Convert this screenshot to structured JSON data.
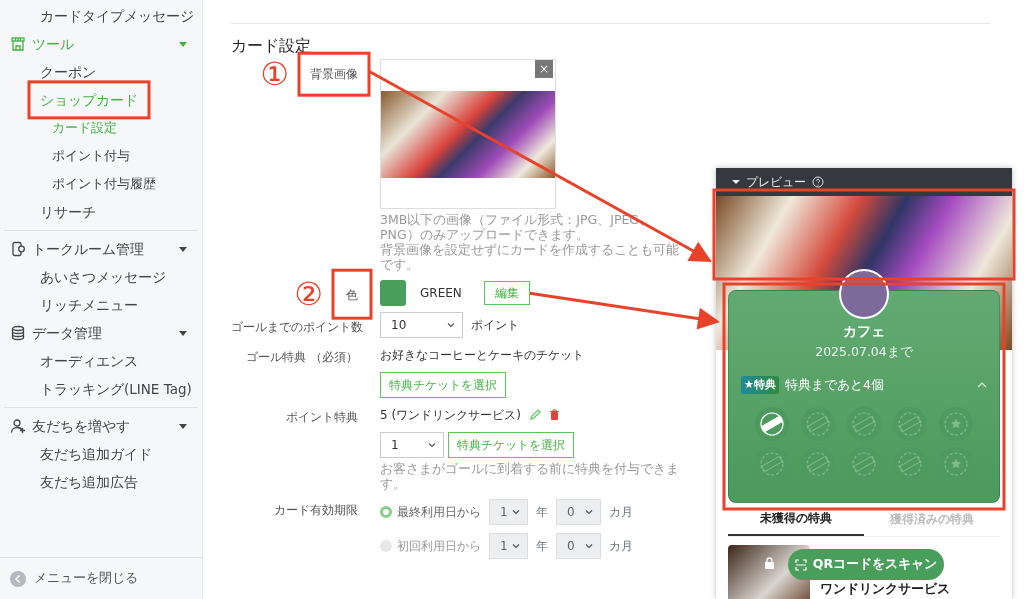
{
  "sidebar": {
    "entries": [
      {
        "kind": "item",
        "label": "カードタイプメッセージ",
        "selected": false
      },
      {
        "kind": "section",
        "label": "ツール",
        "selected": true,
        "expanded": true,
        "children": [
          {
            "label": "クーポン",
            "selected": false
          },
          {
            "label": "ショップカード",
            "selected": true,
            "children": [
              {
                "label": "カード設定",
                "selected": true
              },
              {
                "label": "ポイント付与",
                "selected": false
              },
              {
                "label": "ポイント付与履歴",
                "selected": false
              }
            ]
          },
          {
            "label": "リサーチ",
            "selected": false
          }
        ]
      },
      {
        "kind": "divider"
      },
      {
        "kind": "section",
        "label": "トークルーム管理",
        "selected": false,
        "expanded": true,
        "children": [
          {
            "label": "あいさつメッセージ",
            "selected": false
          },
          {
            "label": "リッチメニュー",
            "selected": false
          }
        ]
      },
      {
        "kind": "section",
        "label": "データ管理",
        "selected": false,
        "expanded": true,
        "children": [
          {
            "label": "オーディエンス",
            "selected": false
          },
          {
            "label": "トラッキング(LINE Tag)",
            "selected": false
          }
        ]
      },
      {
        "kind": "divider"
      },
      {
        "kind": "section",
        "label": "友だちを増やす",
        "selected": false,
        "expanded": true,
        "children": [
          {
            "label": "友だち追加ガイド",
            "selected": false
          },
          {
            "label": "友だち追加広告",
            "selected": false
          }
        ]
      }
    ],
    "close_label": "メニューを閉じる"
  },
  "main": {
    "title": "カード設定",
    "fields": [
      {
        "kind": "image",
        "label": "背景画像",
        "remove_button": "×",
        "help": [
          "3MB以下の画像（ファイル形式：JPG、JPEG、PNG）のみアップロードできます。",
          "背景画像を設定せずにカードを作成することも可能です。"
        ]
      },
      {
        "kind": "color",
        "label": "色",
        "color": "#4a9e5c",
        "color_name": "GREEN",
        "button": "編集"
      },
      {
        "kind": "select",
        "label": "ゴールまでのポイント数",
        "value": "10",
        "unit": "ポイント"
      },
      {
        "kind": "reward",
        "label": "ゴール特典 （必須）",
        "text": "お好きなコーヒーとケーキのチケット",
        "button": "特典チケットを選択"
      },
      {
        "kind": "point_reward",
        "label": "ポイント特典",
        "text": "5 (ワンドリンクサービス)",
        "select_value": "1",
        "button": "特典チケットを選択",
        "help": "お客さまがゴールに到着する前に特典を付与できます。"
      },
      {
        "kind": "expiry",
        "label": "カード有効期限",
        "options": [
          {
            "label": "最終利用日から",
            "selected": true,
            "years": "1",
            "year_unit": "年",
            "months": "0",
            "month_unit": "カ月"
          },
          {
            "label": "初回利用日から",
            "selected": false,
            "years": "1",
            "year_unit": "年",
            "months": "0",
            "month_unit": "カ月"
          }
        ]
      }
    ]
  },
  "preview": {
    "title": "プレビュー",
    "expanded": true,
    "shop_name": "カフェ",
    "expiry": "2025.07.04まで",
    "badge": "★特典",
    "remaining": "特典まであと4個",
    "stamps": [
      {
        "kind": "stamp",
        "collected": true
      },
      {
        "kind": "stamp",
        "collected": false
      },
      {
        "kind": "stamp",
        "collected": false
      },
      {
        "kind": "stamp",
        "collected": false
      },
      {
        "kind": "star",
        "collected": false
      },
      {
        "kind": "stamp",
        "collected": false
      },
      {
        "kind": "stamp",
        "collected": false
      },
      {
        "kind": "stamp",
        "collected": false
      },
      {
        "kind": "stamp",
        "collected": false
      },
      {
        "kind": "star",
        "collected": false
      }
    ],
    "tabs": [
      {
        "label": "未獲得の特典",
        "selected": true
      },
      {
        "label": "獲得済みの特典",
        "selected": false
      }
    ],
    "reward_title": "ワンドリンクサービス",
    "scan_button": "QRコードをスキャン"
  },
  "annotations": {
    "markers": [
      "①",
      "②"
    ]
  }
}
